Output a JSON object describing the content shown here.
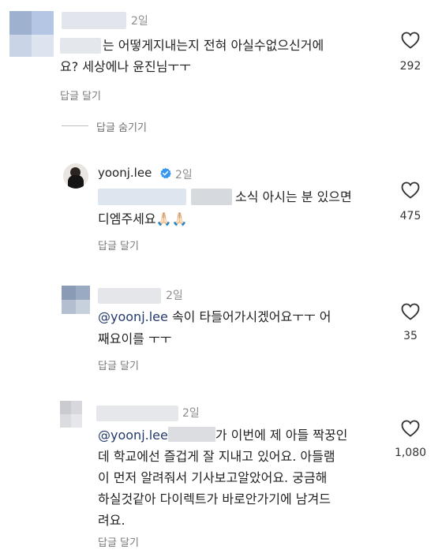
{
  "comments": [
    {
      "time": "2일",
      "text_l1": "는 어떻게지내는지 전혀 아실수없으신거에",
      "text_l2": "요? 세상에나 윤진님ㅜㅜ",
      "reply": "답글 달기",
      "likes": "292"
    },
    {
      "username": "yoonj.lee",
      "time": "2일",
      "text_l1": "소식 아시는 분 있으면",
      "text_l2": "디엠주세요",
      "emoji": "🙏🏻🙏🏻",
      "reply": "답글 달기",
      "likes": "475"
    },
    {
      "time": "2일",
      "mention": "@yoonj.lee",
      "text_l1": " 속이 타들어가시겠어요ㅜㅜ 어",
      "text_l2": "째요이를 ㅜㅜ",
      "reply": "답글 달기",
      "likes": "35"
    },
    {
      "time": "2일",
      "mention": "@yoonj.lee",
      "text_l1": "가 이번에 제 아들 짝꿍인",
      "text_l2": "데 학교에선 즐겁게 잘 지내고 있어요. 아들램",
      "text_l3": "이 먼저 알려줘서 기사보고알았어요. 궁금해",
      "text_l4": "하실것같아 다이렉트가 바로안가기에 남겨드",
      "text_l5": "려요.",
      "reply": "답글 달기",
      "likes": "1,080"
    }
  ],
  "hide_replies": "답글 숨기기"
}
